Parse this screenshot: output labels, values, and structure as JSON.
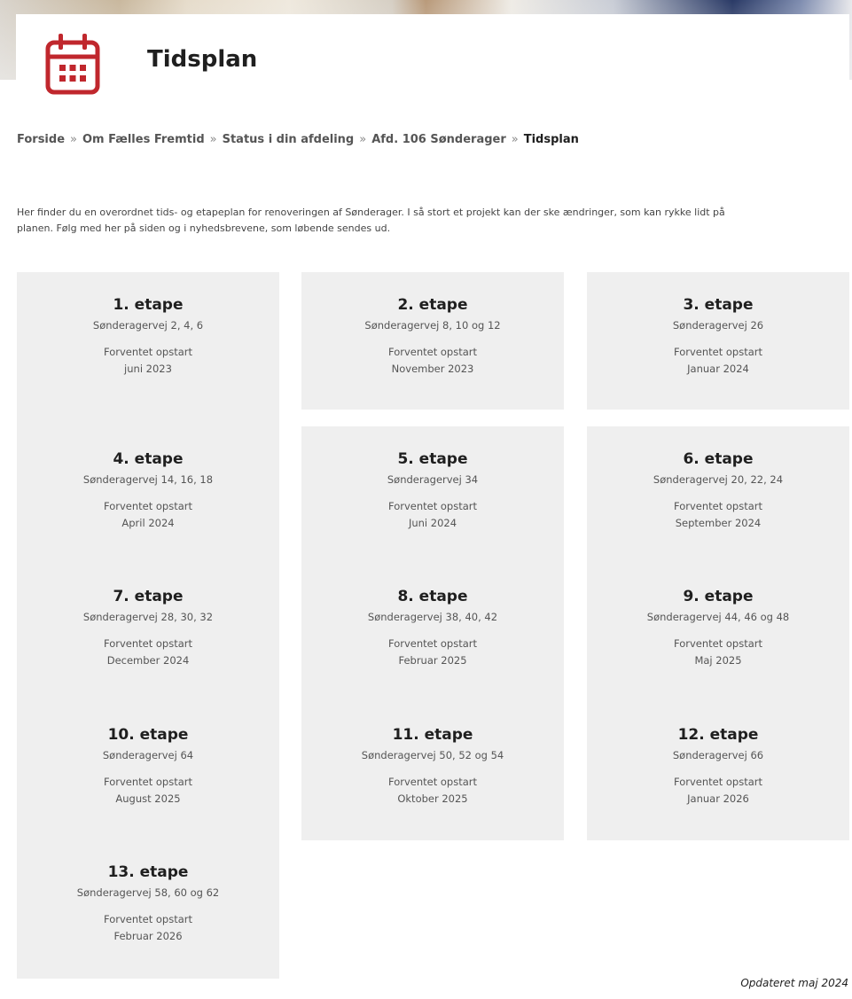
{
  "header": {
    "title": "Tidsplan",
    "icon": "calendar-icon",
    "accent_color": "#c0272d"
  },
  "breadcrumb": {
    "items": [
      "Forside",
      "Om Fælles Fremtid",
      "Status i din afdeling",
      "Afd. 106 Sønderager"
    ],
    "separator": "»",
    "current": "Tidsplan"
  },
  "intro": {
    "line1": "Her finder du en overordnet tids- og etapeplan for renoveringen af Sønderager. I så stort et projekt kan der ske ændringer, som kan rykke lidt på",
    "line2": "planen. Følg med her på siden og i nyhedsbrevene, som løbende sendes ud."
  },
  "stages": [
    {
      "title": "1. etape",
      "address": "Sønderagervej 2, 4, 6",
      "label": "Forventet opstart",
      "date": "juni 2023"
    },
    {
      "title": "2. etape",
      "address": "Sønderagervej 8, 10 og 12",
      "label": "Forventet opstart",
      "date": "November 2023"
    },
    {
      "title": "3. etape",
      "address": "Sønderagervej 26",
      "label": "Forventet opstart",
      "date": "Januar 2024"
    },
    {
      "title": "4. etape",
      "address": "Sønderagervej 14, 16, 18",
      "label": "Forventet opstart",
      "date": "April 2024"
    },
    {
      "title": "5. etape",
      "address": "Sønderagervej 34",
      "label": "Forventet opstart",
      "date": "Juni 2024"
    },
    {
      "title": "6. etape",
      "address": "Sønderagervej 20, 22, 24",
      "label": "Forventet opstart",
      "date": "September 2024"
    },
    {
      "title": "7. etape",
      "address": "Sønderagervej 28, 30, 32",
      "label": "Forventet opstart",
      "date": "December 2024"
    },
    {
      "title": "8. etape",
      "address": "Sønderagervej 38, 40, 42",
      "label": "Forventet opstart",
      "date": "Februar 2025"
    },
    {
      "title": "9. etape",
      "address": "Sønderagervej 44, 46 og 48",
      "label": "Forventet opstart",
      "date": "Maj 2025"
    },
    {
      "title": "10. etape",
      "address": "Sønderagervej 64",
      "label": "Forventet opstart",
      "date": "August 2025"
    },
    {
      "title": "11. etape",
      "address": "Sønderagervej 50, 52 og 54",
      "label": "Forventet opstart",
      "date": "Oktober 2025"
    },
    {
      "title": "12. etape",
      "address": "Sønderagervej 66",
      "label": "Forventet opstart",
      "date": "Januar 2026"
    },
    {
      "title": "13. etape",
      "address": "Sønderagervej 58, 60 og 62",
      "label": "Forventet opstart",
      "date": "Februar 2026"
    }
  ],
  "footer": {
    "updated": "Opdateret maj 2024"
  }
}
